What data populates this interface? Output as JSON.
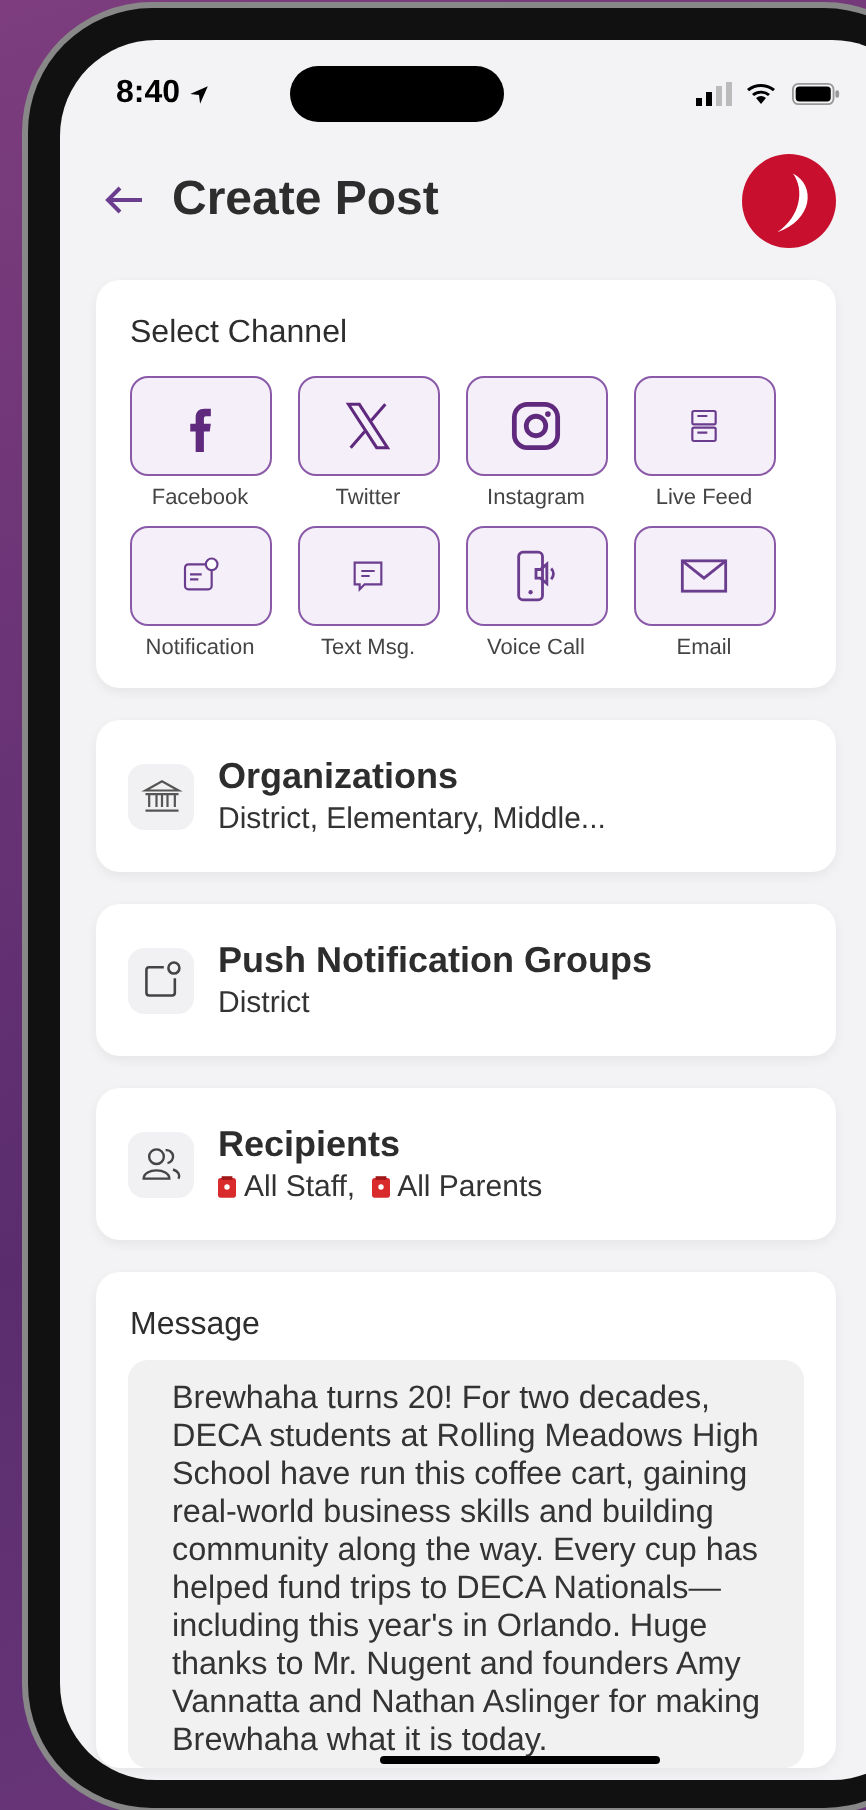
{
  "status_bar": {
    "time": "8:40"
  },
  "header": {
    "title": "Create Post"
  },
  "channel_section": {
    "title": "Select Channel",
    "channels": [
      {
        "label": "Facebook",
        "kind": "facebook"
      },
      {
        "label": "Twitter",
        "kind": "x"
      },
      {
        "label": "Instagram",
        "kind": "instagram"
      },
      {
        "label": "Live Feed",
        "kind": "feed"
      },
      {
        "label": "Notification",
        "kind": "notification"
      },
      {
        "label": "Text Msg.",
        "kind": "text"
      },
      {
        "label": "Voice Call",
        "kind": "voice"
      },
      {
        "label": "Email",
        "kind": "email"
      }
    ]
  },
  "settings": [
    {
      "kind": "organizations",
      "title": "Organizations",
      "value": "District, Elementary, Middle..."
    },
    {
      "kind": "groups",
      "title": "Push Notification Groups",
      "value": "District"
    },
    {
      "kind": "recipients",
      "title": "Recipients",
      "tags": [
        {
          "label": "All Staff,"
        },
        {
          "label": "All Parents"
        }
      ]
    }
  ],
  "message": {
    "label": "Message",
    "value": "Brewhaha turns 20! For two decades, DECA students at Rolling Meadows High School have run this coffee cart, gaining real-world business skills and building community along the way. Every cup has helped fund trips to DECA Nationals—including this year's in Orlando. Huge thanks to Mr. Nugent and founders Amy Vannatta and Nathan Aslinger for making Brewhaha what it is today."
  }
}
